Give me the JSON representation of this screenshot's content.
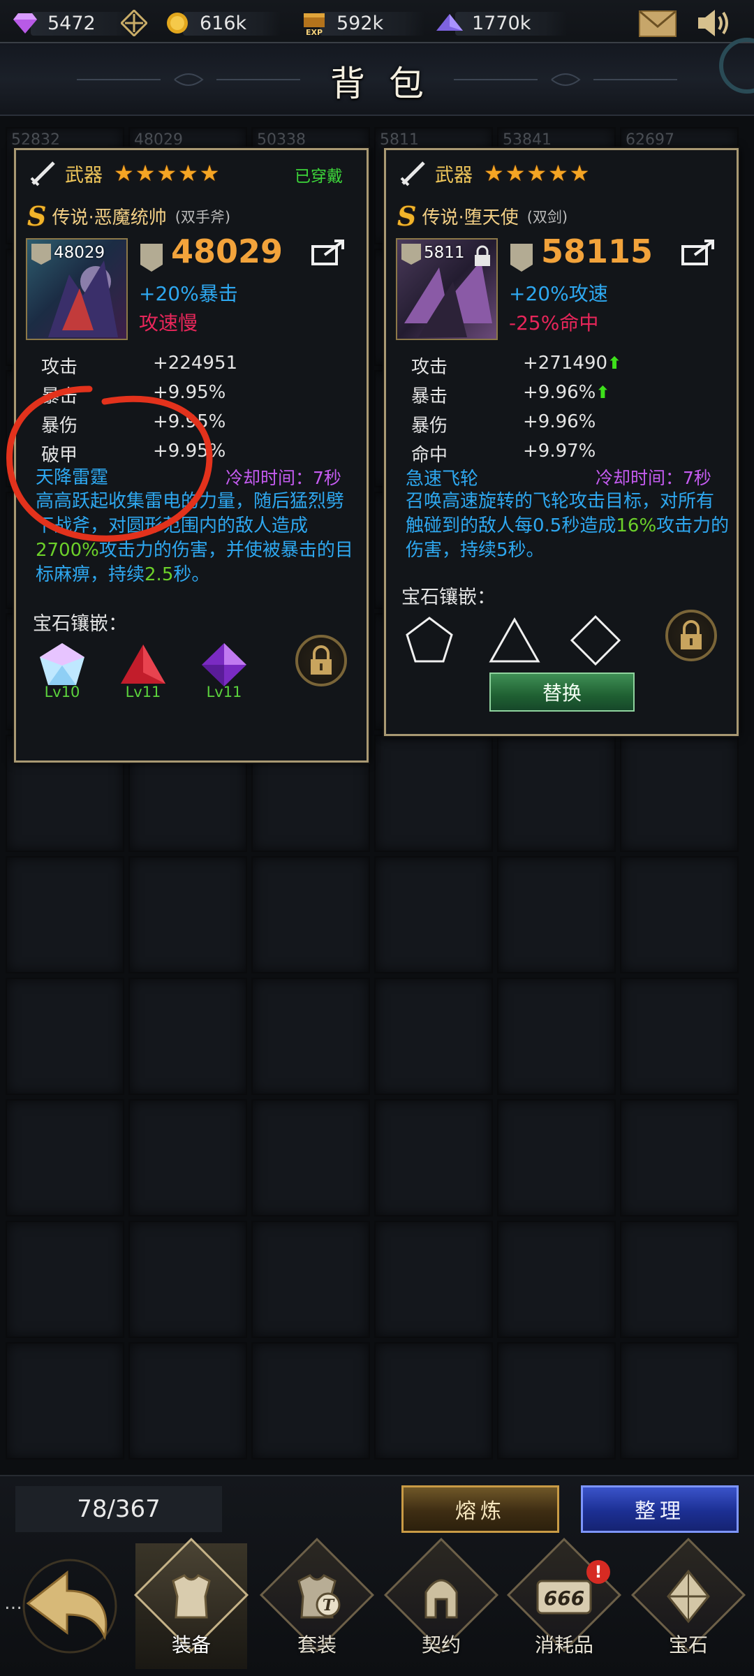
{
  "resources": [
    {
      "icon": "purple-gem-icon",
      "value": "5472"
    },
    {
      "icon": "crosshair-icon",
      "value": ""
    },
    {
      "icon": "gold-coin-icon",
      "value": "616k"
    },
    {
      "icon": "exp-chest-icon",
      "value": "592k"
    },
    {
      "icon": "purple-crystal-pyramid-icon",
      "value": "1770k"
    }
  ],
  "top_icons": [
    "mail-icon",
    "sound-icon"
  ],
  "page_title": "背包",
  "grid_tags": [
    "52832",
    "48029",
    "50338",
    "5811",
    "53841",
    "62697"
  ],
  "cards": [
    {
      "slot": "武器",
      "stars": 5,
      "status": "已穿戴",
      "rarity": "S",
      "name": "传说·恶魔统帅",
      "type": "(双手斧)",
      "thumb_level": "48029",
      "power": "48029",
      "bonus1": "+20%暴击",
      "bonus2": "攻速慢",
      "stats": [
        {
          "label": "攻击",
          "value": "+224951"
        },
        {
          "label": "暴击",
          "value": "+9.95%"
        },
        {
          "label": "暴伤",
          "value": "+9.95%"
        },
        {
          "label": "破甲",
          "value": "+9.95%"
        }
      ],
      "skill_name": "天降雷霆",
      "cooldown": "冷却时间：7秒",
      "skill_desc_a": "高高跃起收集雷电的力量，随后猛烈劈下战斧，对圆形范围内的敌人造成",
      "skill_desc_hl1": "2700%",
      "skill_desc_b": "攻击力的伤害，并使被暴击的目标麻痹，持续",
      "skill_desc_hl2": "2.5",
      "skill_desc_c": "秒。",
      "gem_label": "宝石镶嵌：",
      "gems": [
        {
          "icon": "diamond-gem-icon",
          "level": "Lv10"
        },
        {
          "icon": "ruby-gem-icon",
          "level": "Lv11"
        },
        {
          "icon": "amethyst-gem-icon",
          "level": "Lv11"
        }
      ]
    },
    {
      "slot": "武器",
      "stars": 5,
      "status": "",
      "rarity": "S",
      "name": "传说·堕天使",
      "type": "(双剑)",
      "thumb_level": "5811",
      "power": "58115",
      "bonus1": "+20%攻速",
      "bonus2": "-25%命中",
      "stats": [
        {
          "label": "攻击",
          "value": "+271490"
        },
        {
          "label": "暴击",
          "value": "+9.96%"
        },
        {
          "label": "暴伤",
          "value": "+9.96%"
        },
        {
          "label": "命中",
          "value": "+9.97%"
        }
      ],
      "skill_name": "急速飞轮",
      "cooldown": "冷却时间：7秒",
      "skill_desc_a": "召唤高速旋转的飞轮攻击目标，对所有触碰到的敌人每0.5秒造成",
      "skill_desc_hl1": "16%",
      "skill_desc_b": "攻击力的伤害，持续5秒。",
      "gem_label": "宝石镶嵌：",
      "gem_slots": [
        "pentagon-slot-icon",
        "triangle-slot-icon",
        "diamond-slot-icon"
      ],
      "swap_label": "替换"
    }
  ],
  "bottom": {
    "capacity": "78/367",
    "smelt_label": "熔炼",
    "sort_label": "整理"
  },
  "nav": [
    {
      "label": "装备",
      "icon": "armor-icon",
      "active": true
    },
    {
      "label": "套装",
      "icon": "armor-set-icon"
    },
    {
      "label": "契约",
      "icon": "spartan-helmet-icon"
    },
    {
      "label": "消耗品",
      "icon": "consumable-666-icon",
      "alert": "!"
    },
    {
      "label": "宝石",
      "icon": "gem-icon"
    }
  ]
}
